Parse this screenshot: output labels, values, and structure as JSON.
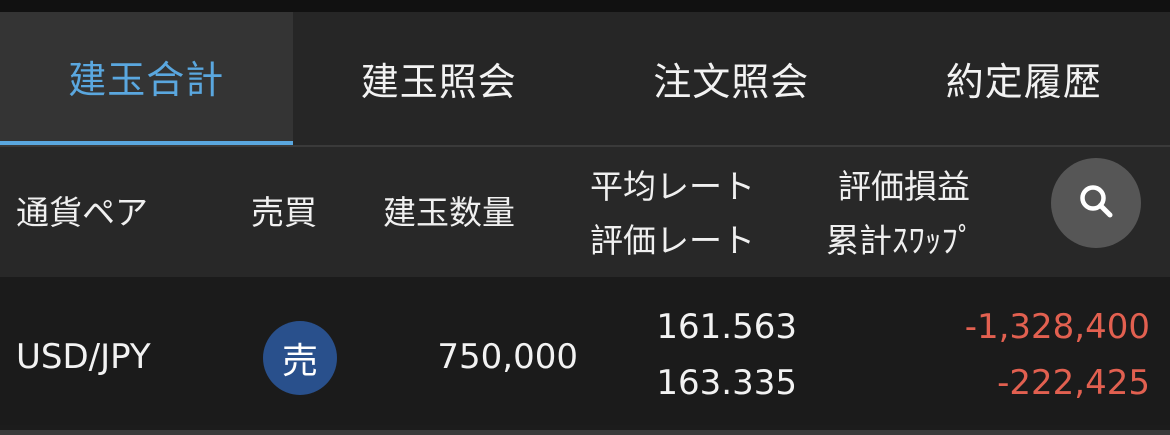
{
  "tabs": [
    "建玉合計",
    "建玉照会",
    "注文照会",
    "約定履歴"
  ],
  "accent_color": "#5aa7df",
  "negative_color": "#e26050",
  "header": {
    "pair": "通貨ペア",
    "side": "売買",
    "quantity": "建玉数量",
    "avg_rate": "平均レート",
    "eval_rate": "評価レート",
    "pnl": "評価損益",
    "swap": "累計ｽﾜｯﾌﾟ",
    "search_icon": "search-icon"
  },
  "rows": [
    {
      "pair": "USD/JPY",
      "side": "売",
      "quantity": "750,000",
      "avg_rate": "161.563",
      "eval_rate": "163.335",
      "pnl": "-1,328,400",
      "swap": "-222,425"
    }
  ]
}
